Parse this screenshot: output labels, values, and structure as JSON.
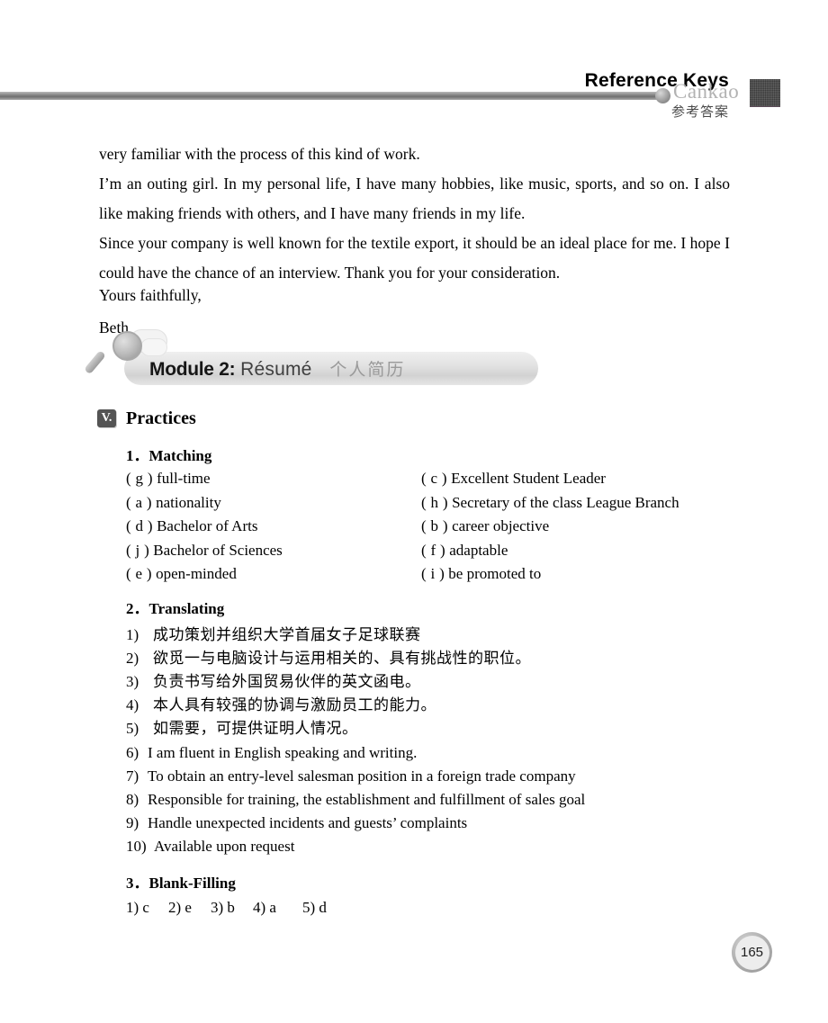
{
  "header": {
    "title": "Reference Keys",
    "pinyin": "Cankao",
    "chinese": "参考答案"
  },
  "body_paragraphs": [
    "very familiar with the process of this kind of work.",
    "I’m an outing girl. In my personal life, I have many hobbies, like music, sports, and so on. I also like making friends with others, and I have many friends in my life.",
    "Since your company is well known for the textile export, it should be an ideal place for me. I hope I could have the chance of an interview. Thank you for your consideration.",
    "Yours faithfully,",
    "Beth"
  ],
  "module_banner": {
    "label": "Module 2:",
    "english": "Résumé",
    "chinese": "个人简历"
  },
  "section": {
    "numeral": "V.",
    "title": "Practices"
  },
  "subsections": {
    "matching": "1．Matching",
    "translating": "2．Translating",
    "blank_filling": "3．Blank-Filling"
  },
  "matching": {
    "left": [
      {
        "tag": "( g )",
        "text": "full-time"
      },
      {
        "tag": "( a )",
        "text": "nationality"
      },
      {
        "tag": "( d )",
        "text": "Bachelor of Arts"
      },
      {
        "tag": "( j )",
        "text": "Bachelor of Sciences"
      },
      {
        "tag": "( e )",
        "text": "open-minded"
      }
    ],
    "right": [
      {
        "tag": "( c )",
        "text": "Excellent Student Leader"
      },
      {
        "tag": "( h )",
        "text": "Secretary of the class League Branch"
      },
      {
        "tag": "( b )",
        "text": "career objective"
      },
      {
        "tag": "( f )",
        "text": "adaptable"
      },
      {
        "tag": "( i )",
        "text": "be promoted to"
      }
    ]
  },
  "translating": [
    {
      "num": "1)",
      "text": "成功策划并组织大学首届女子足球联赛",
      "lang": "cn"
    },
    {
      "num": "2)",
      "text": "欲觅一与电脑设计与运用相关的、具有挑战性的职位。",
      "lang": "cn"
    },
    {
      "num": "3)",
      "text": "负责书写给外国贸易伙伴的英文函电。",
      "lang": "cn"
    },
    {
      "num": "4)",
      "text": "本人具有较强的协调与激励员工的能力。",
      "lang": "cn"
    },
    {
      "num": "5)",
      "text": "如需要，可提供证明人情况。",
      "lang": "cn"
    },
    {
      "num": "6)",
      "text": "I am fluent in English speaking and writing.",
      "lang": "en"
    },
    {
      "num": "7)",
      "text": "To obtain an entry-level salesman position in a foreign trade company",
      "lang": "en"
    },
    {
      "num": "8)",
      "text": "Responsible for training, the establishment and fulfillment of sales goal",
      "lang": "en"
    },
    {
      "num": "9)",
      "text": "Handle unexpected incidents and guests’ complaints",
      "lang": "en"
    },
    {
      "num": "10)",
      "text": "Available upon request",
      "lang": "en"
    }
  ],
  "blank_filling": [
    {
      "num": "1)",
      "answer": "c"
    },
    {
      "num": "2)",
      "answer": "e"
    },
    {
      "num": "3)",
      "answer": "b"
    },
    {
      "num": "4)",
      "answer": "a"
    },
    {
      "num": "5)",
      "answer": "d"
    }
  ],
  "page_number": "165",
  "colors": {
    "rule": "#8d8d8d",
    "pinyin": "#b2b2b2",
    "banner": "#e2e2e2",
    "badge": "#545454",
    "header_block": "#3b3b3b"
  }
}
